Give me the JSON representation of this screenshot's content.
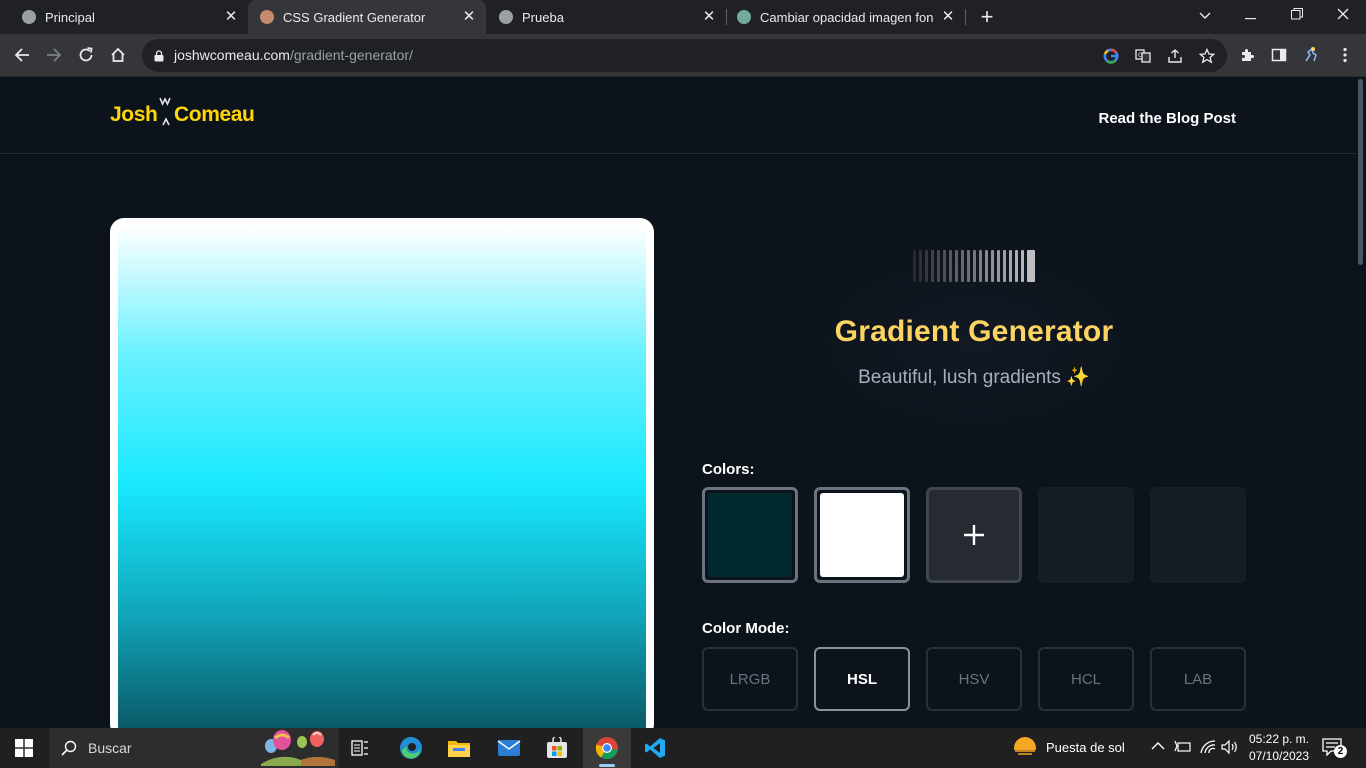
{
  "browser": {
    "tabs": [
      {
        "title": "Principal",
        "active": false
      },
      {
        "title": "CSS Gradient Generator",
        "active": true
      },
      {
        "title": "Prueba",
        "active": false
      },
      {
        "title": "Cambiar opacidad imagen fondo",
        "active": false
      }
    ],
    "url_domain": "joshwcomeau.com",
    "url_path": "/gradient-generator/"
  },
  "site": {
    "logo_first": "Josh",
    "logo_last": "Comeau",
    "nav_link": "Read the Blog Post"
  },
  "hero": {
    "title": "Gradient Generator",
    "subtitle": "Beautiful, lush gradients ✨"
  },
  "colors_section": {
    "label": "Colors:",
    "swatches": [
      {
        "color": "#012a30",
        "selected": true
      },
      {
        "color": "#ffffff",
        "selected": true
      },
      {
        "type": "add",
        "label": "+"
      },
      {
        "type": "empty"
      },
      {
        "type": "empty"
      }
    ]
  },
  "color_mode_section": {
    "label": "Color Mode:",
    "modes": [
      "LRGB",
      "HSL",
      "HSV",
      "HCL",
      "LAB"
    ],
    "selected": "HSL"
  },
  "preview_gradient": {
    "direction": "to bottom",
    "stops": [
      "#ffffff",
      "#68f1ff",
      "#18e8ff",
      "#10a4b8",
      "#0a4f5c"
    ]
  },
  "taskbar": {
    "search_placeholder": "Buscar",
    "weather": "Puesta de sol",
    "time": "05:22 p. m.",
    "date": "07/10/2023",
    "notifications": "2"
  },
  "colors": {
    "accent_yellow": "#ffd60a",
    "title_yellow": "#fcd462",
    "page_bg": "#0d131b"
  }
}
